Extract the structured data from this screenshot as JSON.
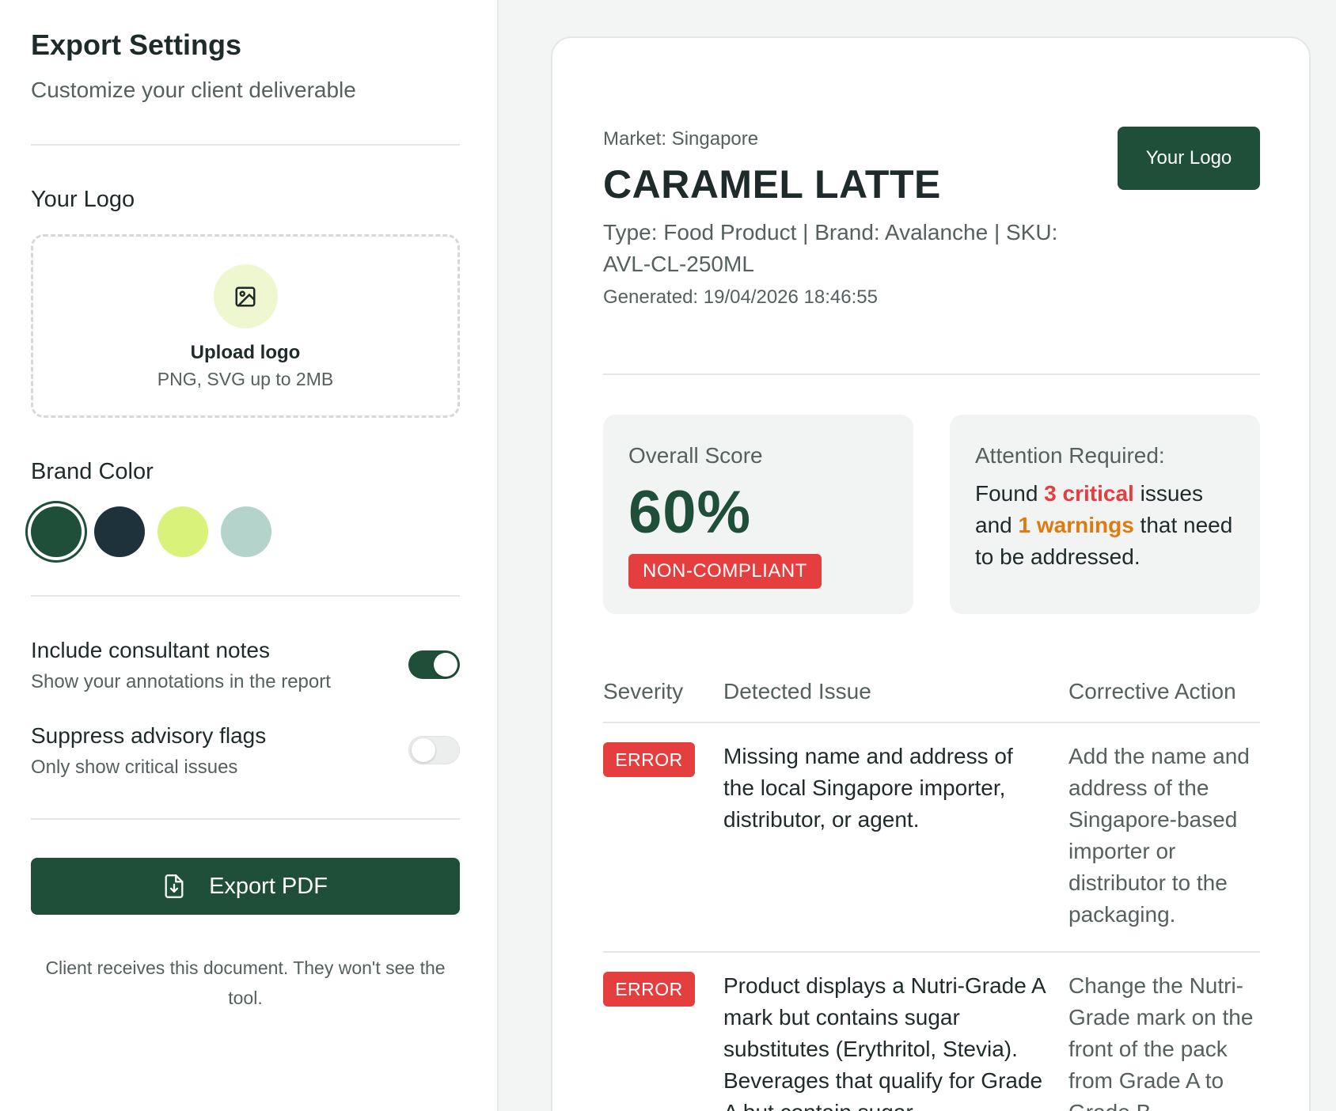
{
  "sidebar": {
    "title": "Export Settings",
    "subtitle": "Customize your client deliverable",
    "logo_section_label": "Your Logo",
    "upload": {
      "icon": "image-icon",
      "title": "Upload logo",
      "hint": "PNG, SVG up to 2MB"
    },
    "brand_color_label": "Brand Color",
    "brand_colors": [
      {
        "hex": "#1f4f38",
        "selected": true
      },
      {
        "hex": "#1e323c",
        "selected": false
      },
      {
        "hex": "#d9f27a",
        "selected": false
      },
      {
        "hex": "#b3d3cb",
        "selected": false
      }
    ],
    "options": [
      {
        "title": "Include consultant notes",
        "subtitle": "Show your annotations in the report",
        "enabled": true
      },
      {
        "title": "Suppress advisory flags",
        "subtitle": "Only show critical issues",
        "enabled": false
      }
    ],
    "export_button": {
      "icon": "file-download-icon",
      "label": "Export PDF"
    },
    "footer": "Client receives this document. They won't see the tool."
  },
  "report": {
    "market": "Market: Singapore",
    "product_name": "CARAMEL LATTE",
    "meta": "Type: Food Product | Brand: Avalanche | SKU: AVL-CL-250ML",
    "generated": "Generated: 19/04/2026 18:46:55",
    "logo_placeholder": "Your Logo",
    "score": {
      "label": "Overall Score",
      "value": "60%",
      "status": "NON-COMPLIANT"
    },
    "attention": {
      "label": "Attention Required:",
      "text_before": "Found ",
      "critical": "3 critical",
      "text_middle": " issues and ",
      "warnings": "1 warnings",
      "text_after": " that need to be addressed."
    },
    "table": {
      "headers": [
        "Severity",
        "Detected Issue",
        "Corrective Action"
      ],
      "rows": [
        {
          "severity": "ERROR",
          "issue": "Missing name and address of the local Singapore importer, distributor, or agent.",
          "action": "Add the name and address of the Singapore-based importer or distributor to the packaging."
        },
        {
          "severity": "ERROR",
          "issue": "Product displays a Nutri-Grade A mark but contains sugar substitutes (Erythritol, Stevia). Beverages that qualify for Grade A but contain sugar",
          "action": "Change the Nutri-Grade mark on the front of the pack from Grade A to Grade B"
        }
      ]
    }
  },
  "colors": {
    "brand": "#1f4f38",
    "error": "#e53e3e",
    "warning": "#dd7b10",
    "accent_light": "#eef7cf"
  }
}
